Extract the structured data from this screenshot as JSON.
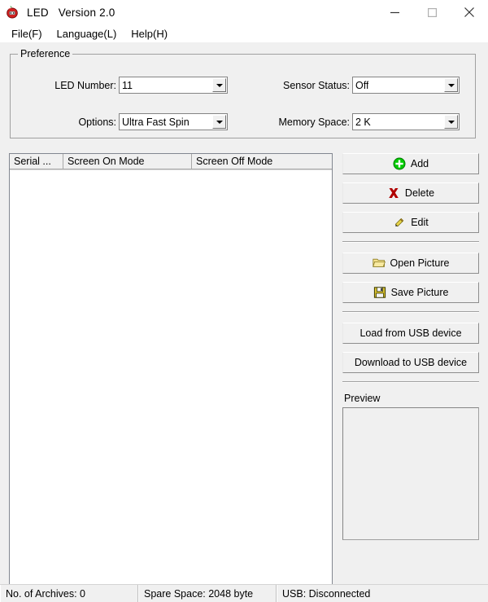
{
  "window": {
    "app_name": "LED",
    "version": "Version 2.0",
    "icon": "apple-icon",
    "controls": {
      "minimize": "minimize-icon",
      "maximize": "maximize-icon",
      "close": "close-icon"
    }
  },
  "menubar": {
    "items": [
      {
        "label": "File(F)",
        "name": "menu-file"
      },
      {
        "label": "Language(L)",
        "name": "menu-language"
      },
      {
        "label": "Help(H)",
        "name": "menu-help"
      }
    ]
  },
  "preference": {
    "title": "Preference",
    "fields": [
      {
        "label": "LED Number:",
        "value": "11"
      },
      {
        "label": "Options:",
        "value": "Ultra Fast Spin"
      },
      {
        "label": "Sensor Status:",
        "value": "Off"
      },
      {
        "label": "Memory Space:",
        "value": "2 K"
      }
    ]
  },
  "list": {
    "columns": [
      {
        "title": "Serial ..."
      },
      {
        "title": "Screen On Mode"
      },
      {
        "title": "Screen Off Mode"
      }
    ],
    "rows": [],
    "scrollbar": {
      "left_arrow": "chevron-left-icon",
      "right_arrow": "chevron-right-icon"
    }
  },
  "actions": {
    "group1": [
      {
        "label": "Add",
        "icon": "plus-circle-icon",
        "color": "#00cc00"
      },
      {
        "label": "Delete",
        "icon": "x-mark-icon",
        "color": "#b00000"
      },
      {
        "label": "Edit",
        "icon": "pencil-icon",
        "color": "#e8d44a"
      }
    ],
    "group2": [
      {
        "label": "Open Picture",
        "icon": "folder-open-icon",
        "color": "#e8c84a"
      },
      {
        "label": "Save Picture",
        "icon": "floppy-disk-icon",
        "color": "#d8c030"
      }
    ],
    "group3": [
      {
        "label": "Load from USB device",
        "icon": "",
        "color": ""
      },
      {
        "label": "Download to USB device",
        "icon": "",
        "color": ""
      }
    ]
  },
  "preview": {
    "label": "Preview"
  },
  "statusbar": {
    "panels": [
      {
        "text": "No. of Archives: 0"
      },
      {
        "text": "Spare Space: 2048 byte"
      },
      {
        "text": "USB: Disconnected"
      }
    ]
  }
}
